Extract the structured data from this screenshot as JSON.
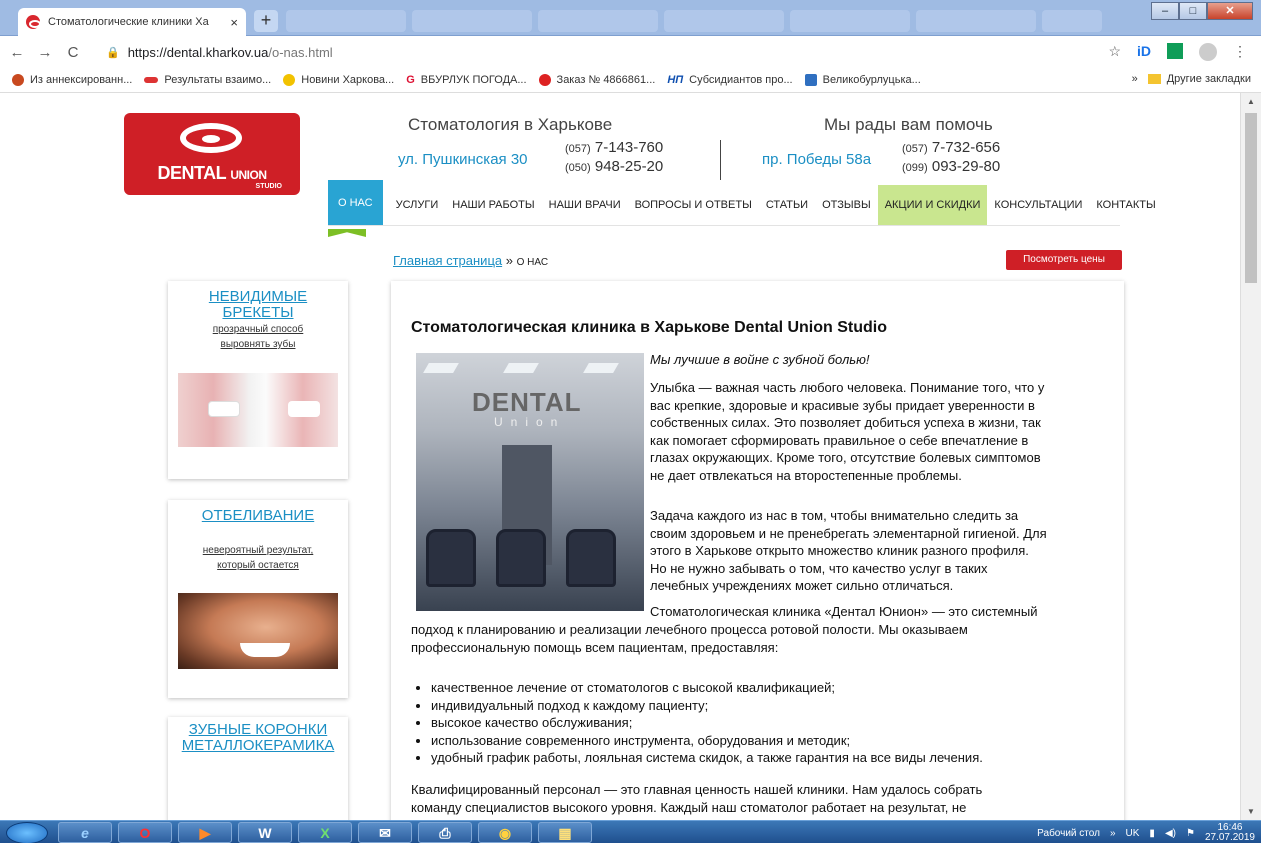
{
  "browser": {
    "tab_title": "Стоматологические клиники Ха",
    "tab_close": "×",
    "new_tab": "+",
    "window_controls": {
      "minimize": "–",
      "maximize": "□",
      "close": "✕"
    },
    "nav": {
      "back": "←",
      "forward": "→",
      "reload": "C"
    },
    "url_host": "https://dental.kharkov.ua",
    "url_path": "/o-nas.html",
    "bookmarks": [
      "Из аннексированн...",
      "Результаты взаимо...",
      "Новини Харкова...",
      "ВБУРЛУК ПОГОДА...",
      "Заказ № 4866861...",
      "Субсидиантов про...",
      "Великобурлуцька..."
    ],
    "bookmarks_more": "»",
    "other_bookmarks": "Другие закладки",
    "bookmark_icon_labels": {
      "np": "НП",
      "g": "G"
    }
  },
  "site": {
    "logo": {
      "word1": "DENTAL",
      "word2": "UNION",
      "word3": "STUDIO"
    },
    "left_heading": "Стоматология в Харькове",
    "right_heading": "Мы рады вам помочь",
    "left_address": "ул. Пушкинская 30",
    "left_phone1_code": "(057)",
    "left_phone1": "7-143-760",
    "left_phone2_code": "(050)",
    "left_phone2": "948-25-20",
    "right_address": "пр. Победы 58а",
    "right_phone1_code": "(057)",
    "right_phone1": "7-732-656",
    "right_phone2_code": "(099)",
    "right_phone2": "093-29-80",
    "menu": [
      "О НАС",
      "УСЛУГИ",
      "НАШИ РАБОТЫ",
      "НАШИ ВРАЧИ",
      "ВОПРОСЫ И ОТВЕТЫ",
      "СТАТЬИ",
      "ОТЗЫВЫ",
      "АКЦИИ И СКИДКИ",
      "КОНСУЛЬТАЦИИ",
      "КОНТАКТЫ"
    ],
    "breadcrumb_home": "Главная страница",
    "breadcrumb_sep": " » ",
    "breadcrumb_current": "О НАС",
    "price_button": "Посмотреть цены",
    "sidebar": [
      {
        "title1": "НЕВИДИМЫЕ",
        "title2": "БРЕКЕТЫ",
        "sub1": "прозрачный способ",
        "sub2": "выровнять зубы"
      },
      {
        "title1": "ОТБЕЛИВАНИЕ",
        "title2": "",
        "sub1": "невероятный результат,",
        "sub2": "который остается"
      },
      {
        "title1": "ЗУБНЫЕ КОРОНКИ",
        "title2": "МЕТАЛЛОКЕРАМИКА",
        "sub1": "",
        "sub2": ""
      }
    ],
    "article": {
      "title": "Стоматологическая клиника в Харькове Dental Union Studio",
      "photo_text1": "DENTAL",
      "photo_text2": "Union",
      "slogan": "Мы лучшие в войне с зубной болью!",
      "p1_lines": [
        "Улыбка — важная часть любого человека. Понимание того, что у",
        "вас крепкие, здоровые и красивые зубы придает уверенности в",
        "собственных силах. Это позволяет добиться успеха в жизни, так",
        "как помогает сформировать правильное о себе впечатление в",
        "глазах окружающих. Кроме того, отсутствие болевых симптомов",
        "не дает отвлекаться на второстепенные проблемы."
      ],
      "p2_lines": [
        "Задача каждого из нас в том, чтобы внимательно следить за",
        "своим здоровьем и не пренебрегать элементарной гигиеной. Для",
        "этого в Харькове открыто множество клиник разного профиля.",
        "Но не нужно забывать о том, что качество услуг в таких",
        "лечебных учреждениях может сильно отличаться."
      ],
      "p3_line1": "Стоматологическая клиника «Дентал Юнион» — это системный",
      "p3_line2": "подход к планированию и реализации лечебного процесса ротовой полости. Мы оказываем",
      "p3_line3": "профессиональную помощь всем пациентам, предоставляя:",
      "bullets": [
        "качественное лечение от стоматологов с высокой квалификацией;",
        "индивидуальный подход к каждому пациенту;",
        "высокое качество обслуживания;",
        "использование современного инструмента, оборудования и методик;",
        "удобный график работы, лояльная система скидок, а также гарантия на все виды лечения."
      ],
      "p4_line1": "Квалифицированный персонал — это главная ценность нашей клиники. Нам удалось собрать",
      "p4_line2": "команду специалистов высокого уровня. Каждый наш стоматолог работает на результат, не"
    }
  },
  "taskbar": {
    "desktop_label": "Рабочий стол",
    "lang": "UK",
    "time": "16:46",
    "date": "27.07.2019",
    "app_labels": {
      "word": "W",
      "excel": "X"
    }
  }
}
